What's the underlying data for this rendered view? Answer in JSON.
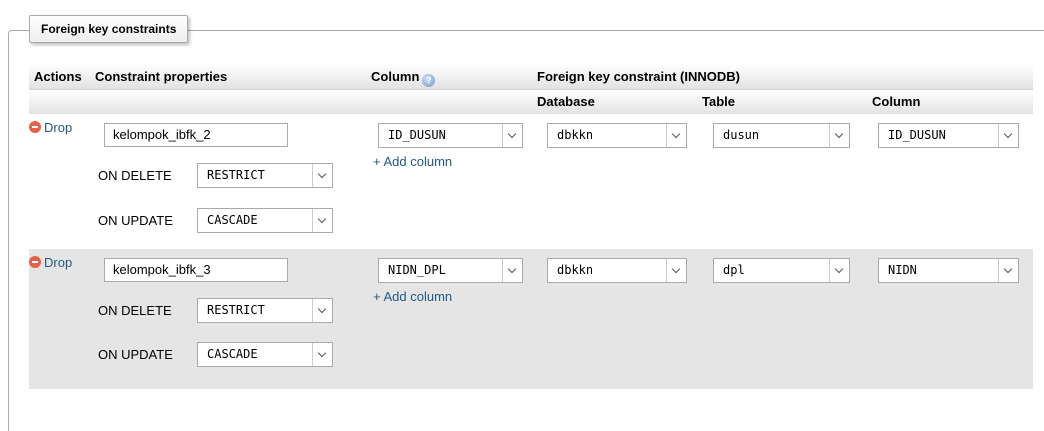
{
  "fieldset": {
    "legend": "Foreign key constraints"
  },
  "headers": {
    "actions": "Actions",
    "constraint_properties": "Constraint properties",
    "column": "Column",
    "foreign_key_group": "Foreign key constraint (INNODB)",
    "database": "Database",
    "table": "Table",
    "ref_column": "Column"
  },
  "on_delete_label": "ON DELETE",
  "on_update_label": "ON UPDATE",
  "drop_label": "Drop",
  "add_column_label": "+ Add column",
  "constraints": [
    {
      "name": "kelompok_ibfk_2",
      "on_delete": "RESTRICT",
      "on_update": "CASCADE",
      "column": "ID_DUSUN",
      "database": "dbkkn",
      "table": "dusun",
      "ref_column": "ID_DUSUN"
    },
    {
      "name": "kelompok_ibfk_3",
      "on_delete": "RESTRICT",
      "on_update": "CASCADE",
      "column": "NIDN_DPL",
      "database": "dbkkn",
      "table": "dpl",
      "ref_column": "NIDN"
    }
  ],
  "colors": {
    "link": "#235a81",
    "row_even": "#e5e5e5",
    "drop_icon": "#e8604a"
  }
}
